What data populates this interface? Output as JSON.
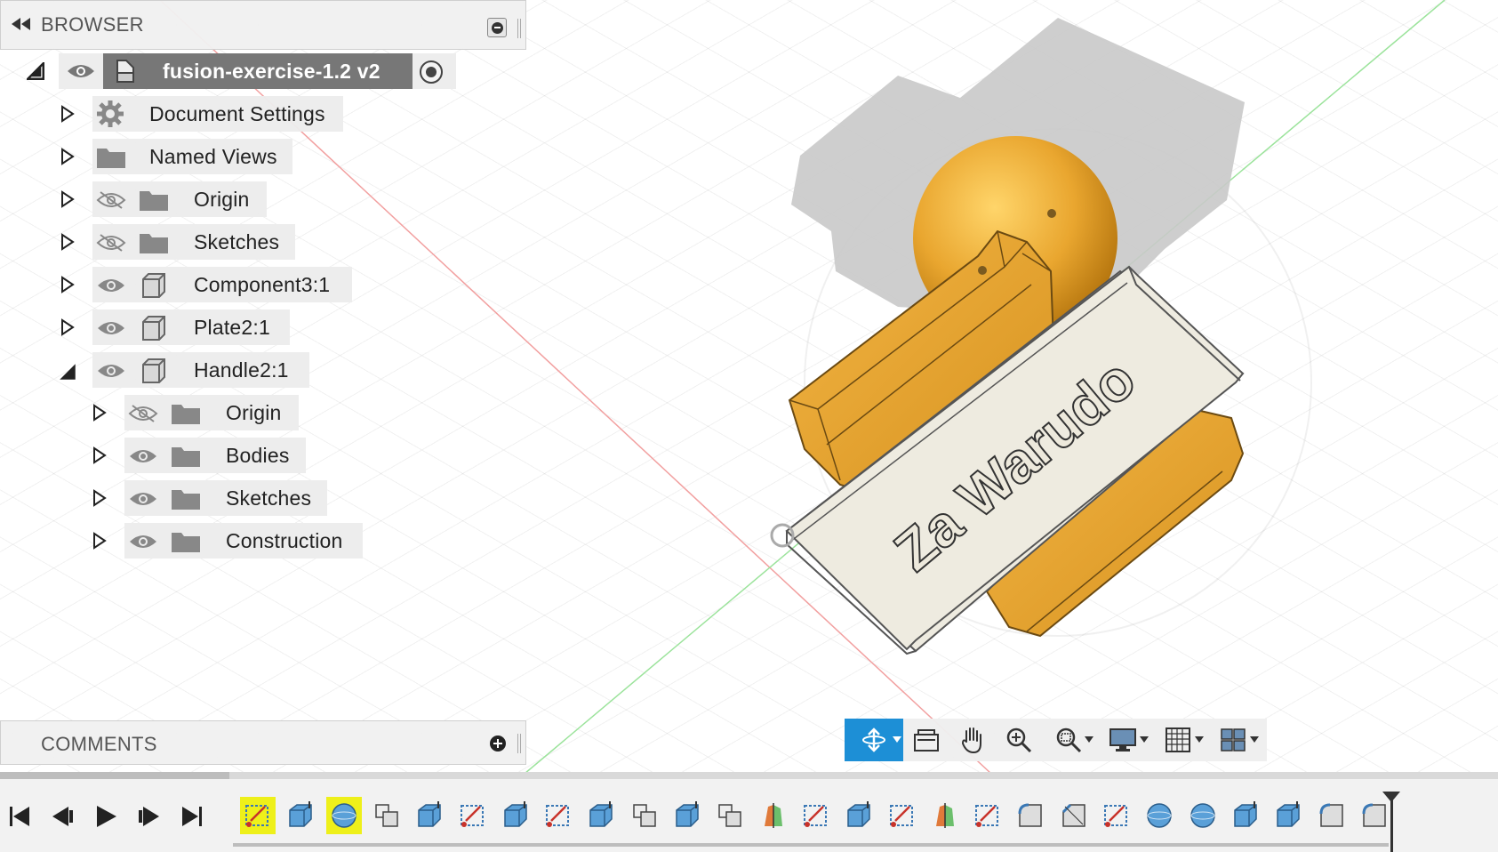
{
  "browser": {
    "title": "BROWSER",
    "root": {
      "label": "fusion-exercise-1.2 v2"
    },
    "items": [
      {
        "label": "Document Settings",
        "icon": "gear-icon"
      },
      {
        "label": "Named Views",
        "icon": "folder-icon"
      },
      {
        "label": "Origin",
        "icon": "folder-icon",
        "visibility": "hidden"
      },
      {
        "label": "Sketches",
        "icon": "folder-icon",
        "visibility": "hidden"
      },
      {
        "label": "Component3:1",
        "icon": "component-icon",
        "visibility": "visible"
      },
      {
        "label": "Plate2:1",
        "icon": "component-icon",
        "visibility": "visible"
      },
      {
        "label": "Handle2:1",
        "icon": "component-icon",
        "visibility": "visible",
        "expanded": true
      },
      {
        "label": "Origin",
        "icon": "folder-icon",
        "visibility": "hidden"
      },
      {
        "label": "Bodies",
        "icon": "folder-icon",
        "visibility": "visible"
      },
      {
        "label": "Sketches",
        "icon": "folder-icon",
        "visibility": "visible"
      },
      {
        "label": "Construction",
        "icon": "folder-icon",
        "visibility": "visible"
      }
    ]
  },
  "comments": {
    "title": "COMMENTS"
  },
  "model": {
    "engraving": "Za Warudo"
  },
  "navbar": {
    "buttons": [
      "orbit-icon",
      "look-at-icon",
      "pan-icon",
      "zoom-icon",
      "fit-icon",
      "display-settings-icon",
      "grid-settings-icon",
      "viewports-icon"
    ]
  },
  "timeline": {
    "controls": [
      "go-to-start-icon",
      "step-back-icon",
      "play-icon",
      "step-forward-icon",
      "go-to-end-icon"
    ],
    "features": [
      "sketch",
      "extrude",
      "sphere",
      "combine",
      "extrude",
      "sketch",
      "extrude",
      "sketch",
      "extrude",
      "combine",
      "extrude",
      "combine",
      "revolve",
      "sketch",
      "extrude",
      "sketch",
      "revolve",
      "sketch",
      "fillet",
      "chamfer",
      "sketch",
      "sphere",
      "sphere",
      "extrude",
      "extrude",
      "fillet",
      "fillet"
    ]
  },
  "colors": {
    "accent": "#1d8fd6",
    "highlight": "#eef01a",
    "body_orange": "#e8a230",
    "plate": "#eeebe0"
  }
}
